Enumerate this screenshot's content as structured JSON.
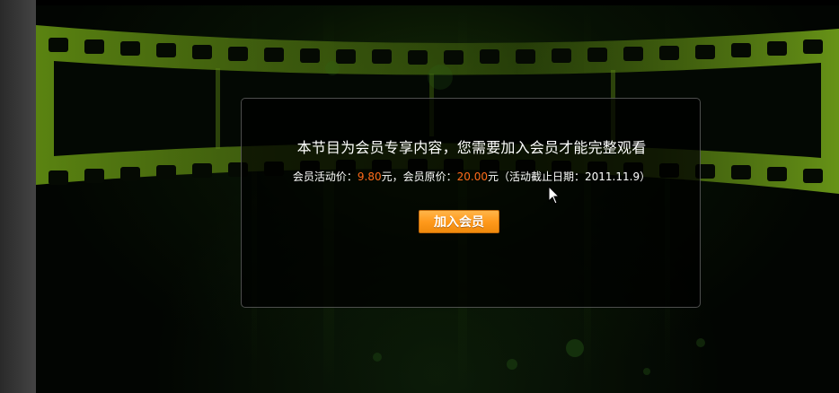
{
  "colors": {
    "highlight_price": "#ff6a1a",
    "button_fill": "#ff9a1c",
    "film_strip": "#6f9a16"
  },
  "modal": {
    "headline": "本节目为会员专享内容，您需要加入会员才能完整观看",
    "price": {
      "activity_label": "会员活动价：",
      "activity_value": "9.80",
      "unit_1": "元，会员原价：",
      "original_value": "20.00",
      "unit_2": "元（活动截止日期：2011.11.9）"
    },
    "join_button": "加入会员"
  },
  "icons": {
    "film_strip": "film-strip-icon",
    "cursor": "mouse-cursor-icon"
  }
}
